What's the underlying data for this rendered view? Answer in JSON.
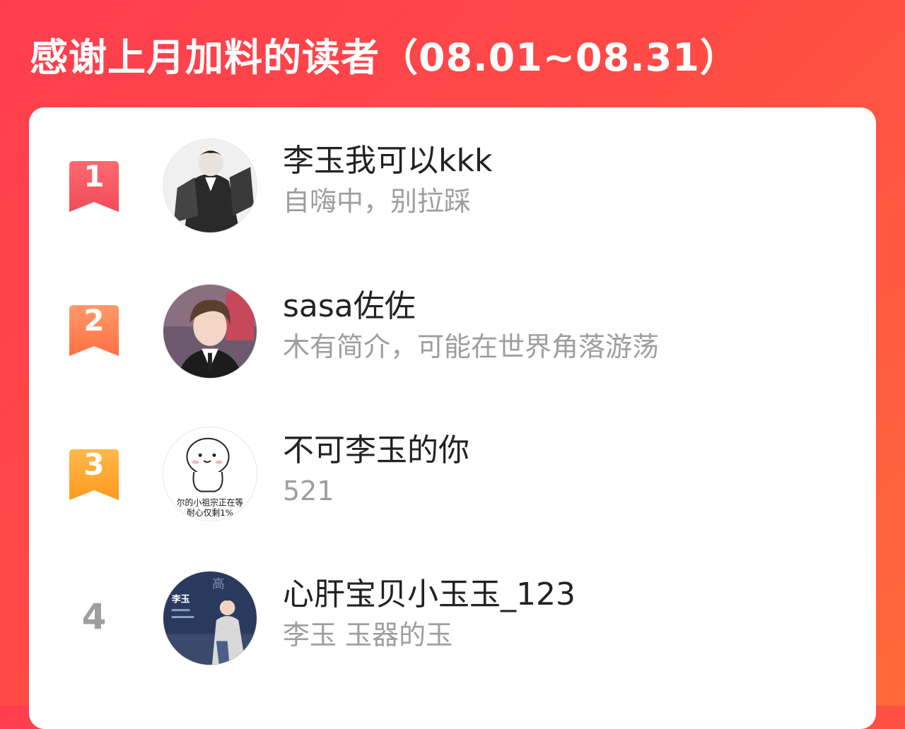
{
  "header": {
    "title": "感谢上月加料的读者（08.01~08.31）"
  },
  "colors": {
    "background_start": "#ff3d4f",
    "background_end": "#ff6a3a",
    "rank1": "#f9555f",
    "rank2": "#ff7c4d",
    "rank3": "#ffa92a",
    "rank_plain": "#9e9e9e",
    "name": "#222222",
    "bio": "#9e9e9e"
  },
  "readers": [
    {
      "rank": "1",
      "name": "李玉我可以kkk",
      "bio": "自嗨中，别拉踩",
      "avatar": "dark-suit-illustration"
    },
    {
      "rank": "2",
      "name": "sasa佐佐",
      "bio": "木有简介，可能在世界角落游荡",
      "avatar": "brown-hair-portrait"
    },
    {
      "rank": "3",
      "name": "不可李玉的你",
      "bio": "521",
      "avatar": "white-blob-meme",
      "avatar_caption": [
        "尔的小祖宗正在等",
        "耐心仅剩1%"
      ]
    },
    {
      "rank": "4",
      "name": "心肝宝贝小玉玉_123",
      "bio": "李玉 玉器的玉",
      "avatar": "character-profile-card",
      "avatar_caption": [
        "李玉",
        "高"
      ]
    }
  ]
}
